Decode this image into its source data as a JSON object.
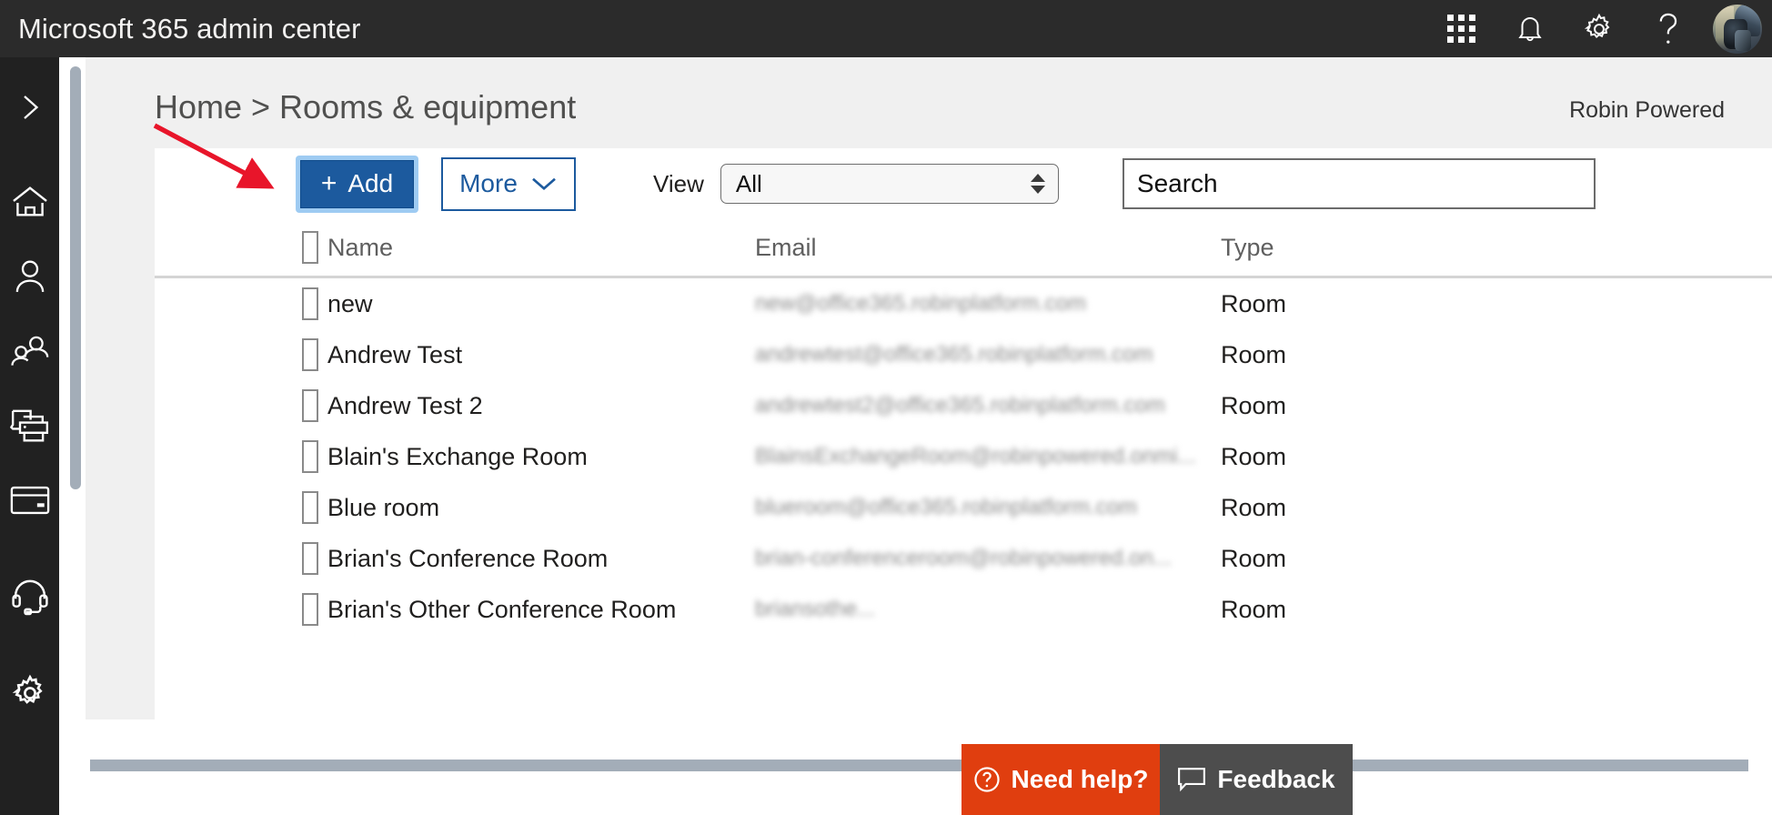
{
  "suite": {
    "title": "Microsoft 365 admin center",
    "icons": [
      {
        "name": "app-launcher-icon",
        "glyph": "waffle"
      },
      {
        "name": "notifications-bell-icon",
        "glyph": "bell"
      },
      {
        "name": "settings-gear-icon",
        "glyph": "gear"
      },
      {
        "name": "help-question-icon",
        "glyph": "question"
      },
      {
        "name": "account-avatar",
        "glyph": "avatar"
      }
    ]
  },
  "rail": {
    "items": [
      {
        "name": "expand-nav-chevron-icon",
        "glyph": "chevron-right"
      },
      {
        "name": "sidebar-item-home",
        "glyph": "home"
      },
      {
        "name": "sidebar-item-users",
        "glyph": "user"
      },
      {
        "name": "sidebar-item-groups",
        "glyph": "people"
      },
      {
        "name": "sidebar-item-devices",
        "glyph": "printer"
      },
      {
        "name": "sidebar-item-billing",
        "glyph": "credit-card"
      },
      {
        "name": "sidebar-item-support",
        "glyph": "headset"
      },
      {
        "name": "sidebar-item-settings",
        "glyph": "gear"
      }
    ]
  },
  "header": {
    "breadcrumb": "Home > Rooms & equipment",
    "tenant": "Robin Powered"
  },
  "toolbar": {
    "add_label": "Add",
    "add_plus": "+",
    "more_label": "More",
    "view_label": "View",
    "view_value": "All",
    "view_options": [
      "All"
    ],
    "search_placeholder": "Search"
  },
  "table": {
    "columns": [
      "Name",
      "Email",
      "Type"
    ],
    "rows": [
      {
        "name": "new",
        "email": "new@office365.robinplatform.com",
        "type": "Room"
      },
      {
        "name": "Andrew Test",
        "email": "andrewtest@office365.robinplatform.com",
        "type": "Room"
      },
      {
        "name": "Andrew Test 2",
        "email": "andrewtest2@office365.robinplatform.com",
        "type": "Room"
      },
      {
        "name": "Blain's Exchange Room",
        "email": "BlainsExchangeRoom@robinpowered.onmi...",
        "type": "Room"
      },
      {
        "name": "Blue room",
        "email": "blueroom@office365.robinplatform.com",
        "type": "Room"
      },
      {
        "name": "Brian's Conference Room",
        "email": "brian-conferenceroom@robinpowered.on...",
        "type": "Room"
      },
      {
        "name": "Brian's Other Conference Room",
        "email": "briansothe...",
        "type": "Room"
      }
    ]
  },
  "help": {
    "need_help_label": "Need help?",
    "feedback_label": "Feedback"
  },
  "colors": {
    "suite_bar": "#2b2b2b",
    "rail": "#212121",
    "accent_blue": "#1c5a9e",
    "focus_ring": "#9ecbf2",
    "need_help_orange": "#e03e0f",
    "feedback_gray": "#4d4d4d",
    "annotation_red": "#e8152a",
    "scrollbar": "#a3adb8",
    "header_band": "#f0f0f0"
  }
}
